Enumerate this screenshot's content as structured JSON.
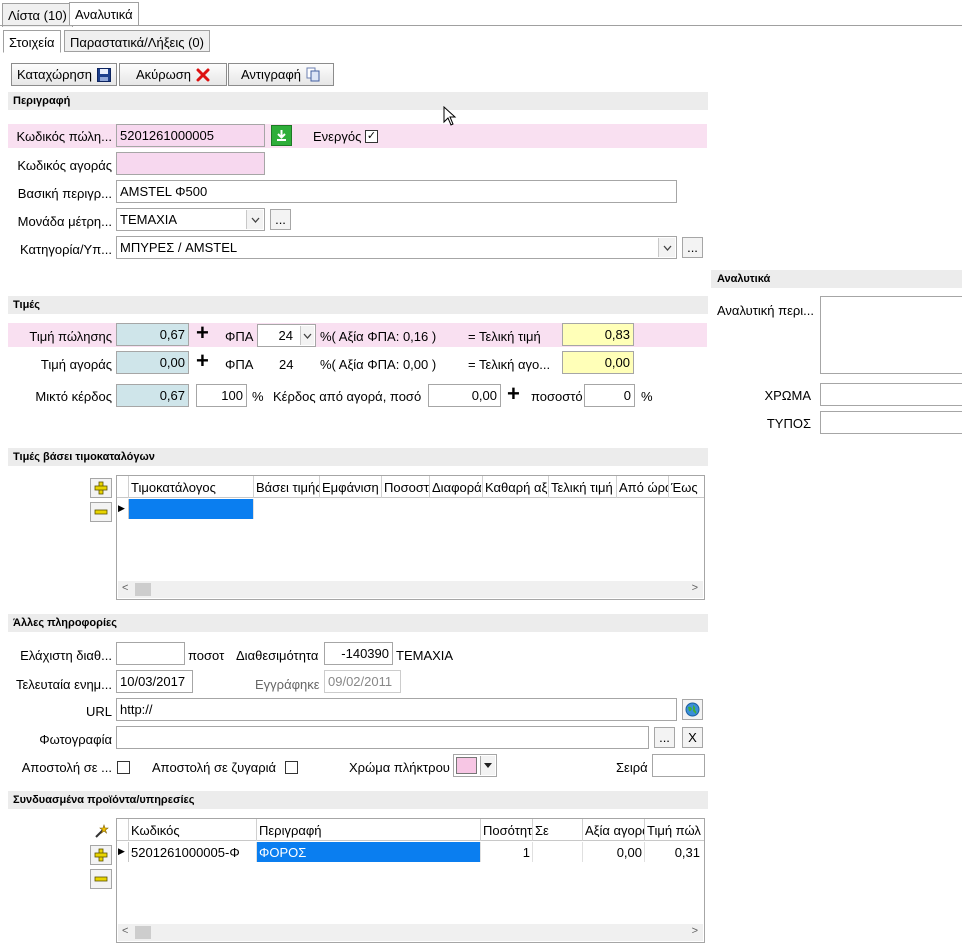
{
  "tabs": {
    "list_label": "Λίστα (10)",
    "detail_label": "Αναλυτικά"
  },
  "subtabs": {
    "details_label": "Στοιχεία",
    "docs_label": "Παραστατικά/Λήξεις (0)"
  },
  "toolbar": {
    "save_label": "Καταχώρηση",
    "cancel_label": "Ακύρωση",
    "copy_label": "Αντιγραφή"
  },
  "description": {
    "title": "Περιγραφή",
    "sale_code_label": "Κωδικός πώλη...",
    "sale_code_value": "5201261000005",
    "active_label": "Ενεργός",
    "active_checked": "✓",
    "buy_code_label": "Κωδικός αγοράς",
    "buy_code_value": "",
    "main_desc_label": "Βασική περιγρ...",
    "main_desc_value": "AMSTEL  Φ500",
    "unit_label": "Μονάδα μέτρη...",
    "unit_value": "ΤΕΜΑΧΙΑ",
    "category_label": "Κατηγορία/Υπ...",
    "category_value": "ΜΠΥΡΕΣ / AMSTEL",
    "more_label": "..."
  },
  "prices": {
    "title": "Τιμές",
    "sale_price_label": "Τιμή πώλησης",
    "sale_price_value": "0,67",
    "vat_label": "ΦΠΑ",
    "sale_vat_value": "24",
    "sale_vat_amount": "%( Αξία ΦΠΑ: 0,16 )",
    "final_price_label": "= Τελική τιμή",
    "final_price_value": "0,83",
    "buy_price_label": "Τιμή αγοράς",
    "buy_price_value": "0,00",
    "buy_vat_value": "24",
    "buy_vat_amount": "%( Αξία ΦΠΑ: 0,00 )",
    "final_buy_label": "= Τελική αγο...",
    "final_buy_value": "0,00",
    "gross_profit_label": "Μικτό κέρδος",
    "gross_profit_value": "0,67",
    "profit_percent_value": "100",
    "percent_sign": "%",
    "profit_amount_label": "Κέρδος από αγορά, ποσό",
    "profit_amount_value": "0,00",
    "profit_rate_label": "ποσοστό",
    "profit_rate_value": "0"
  },
  "pricelists": {
    "title": "Τιμές βάσει τιμοκαταλόγων",
    "columns": [
      "Τιμοκατάλογος",
      "Βάσει τιμής",
      "Εμφάνιση",
      "Ποσοστό",
      "Διαφορά",
      "Καθαρή αξία",
      "Τελική τιμή",
      "Από ώρα",
      "Έως"
    ]
  },
  "analytics": {
    "title": "Αναλυτικά",
    "desc_label": "Αναλυτική περι...",
    "desc_value": "",
    "color_label": "ΧΡΩΜΑ",
    "color_value": "",
    "type_label": "ΤΥΠΟΣ",
    "type_value": ""
  },
  "other": {
    "title": "Άλλες πληροφορίες",
    "min_avail_label": "Ελάχιστη διαθ...",
    "min_avail_value": "",
    "qty_unit_label": "ποσοτ",
    "availability_label": "Διαθεσιμότητα",
    "availability_value": "-140390",
    "availability_unit": "ΤΕΜΑΧΙΑ",
    "last_update_label": "Τελευταία ενημ...",
    "last_update_value": "10/03/2017",
    "registered_label": "Εγγράφηκε",
    "registered_value": "09/02/2011",
    "url_label": "URL",
    "url_value": "http://",
    "photo_label": "Φωτογραφία",
    "photo_value": "",
    "browse_label": "...",
    "clear_label": "X",
    "send_label": "Αποστολή σε ...",
    "send_scale_label": "Αποστολή σε ζυγαριά",
    "key_color_label": "Χρώμα πλήκτρου",
    "key_color_hex": "#f7c6e4",
    "order_label": "Σειρά",
    "order_value": ""
  },
  "related": {
    "title": "Συνδυασμένα προϊόντα/υπηρεσίες",
    "columns": [
      "Κωδικός",
      "Περιγραφή",
      "Ποσότητα",
      "Σε",
      "Αξία αγοράς",
      "Τιμή πώλ"
    ],
    "rows": [
      {
        "code": "5201261000005-Φ",
        "desc": "ΦΟΡΟΣ",
        "qty": "1",
        "in": "",
        "buy_value": "0,00",
        "sale_price": "0,31"
      }
    ]
  },
  "colors": {
    "pink_row": "#f9e0f1",
    "selection": "#0a7ef0",
    "yellow": "#ffffb8",
    "blue_field": "#cfe5ea"
  }
}
